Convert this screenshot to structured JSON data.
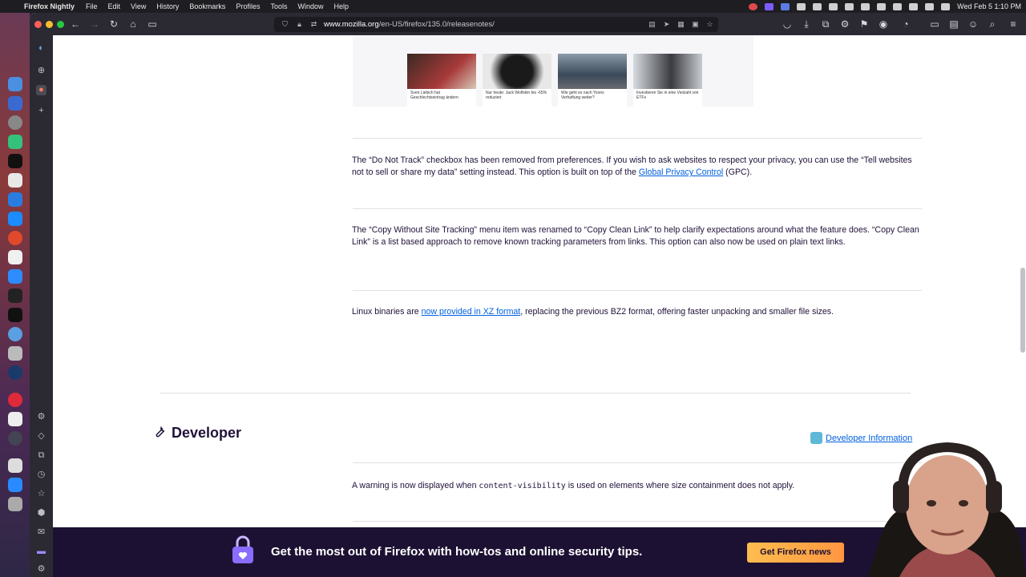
{
  "menubar": {
    "app_name": "Firefox Nightly",
    "menus": [
      "File",
      "Edit",
      "View",
      "History",
      "Bookmarks",
      "Profiles",
      "Tools",
      "Window",
      "Help"
    ],
    "clock": "Wed Feb 5  1:10 PM"
  },
  "browser": {
    "url_host": "www.mozilla.org",
    "url_path": "/en-US/firefox/135.0/releasenotes/"
  },
  "content": {
    "news_cards": [
      {
        "caption": "Sven Liebich hat Geschlechtseintrag ändern"
      },
      {
        "caption": "Nur heute: Jack Wolfskin bis -65% reduziert"
      },
      {
        "caption": "Wie geht es nach Yoons Verhaftung weiter?"
      },
      {
        "caption": "Investieren Sie in eine Vielzahl von ETFs"
      }
    ],
    "para_dnt_1": "The “Do Not Track” checkbox has been removed from preferences. If you wish to ask websites to respect your privacy, you can use the “Tell websites not to sell or share my data” setting instead. This option is built on top of the ",
    "para_dnt_link": "Global Privacy Control",
    "para_dnt_2": " (GPC).",
    "para_copy": "The “Copy Without Site Tracking” menu item was renamed to “Copy Clean Link” to help clarify expectations around what the feature does. “Copy Clean Link” is a list based approach to remove known tracking parameters from links. This option can also now be used on plain text links.",
    "para_linux_1": "Linux binaries are ",
    "para_linux_link": "now provided in XZ format",
    "para_linux_2": ", replacing the previous BZ2 format, offering faster unpacking and smaller file sizes.",
    "dev_heading": "Developer",
    "dev_link": "Developer Information",
    "para_dev_1": "A warning is now displayed when ",
    "para_dev_code": "content-visibility",
    "para_dev_2": " is used on elements where size containment does not apply."
  },
  "banner": {
    "text": "Get the most out of Firefox with how-tos and online security tips.",
    "button": "Get Firefox news"
  },
  "colors": {
    "link": "#0060df",
    "banner_bg": "#1d1133",
    "button_accent": "#ff9640"
  }
}
